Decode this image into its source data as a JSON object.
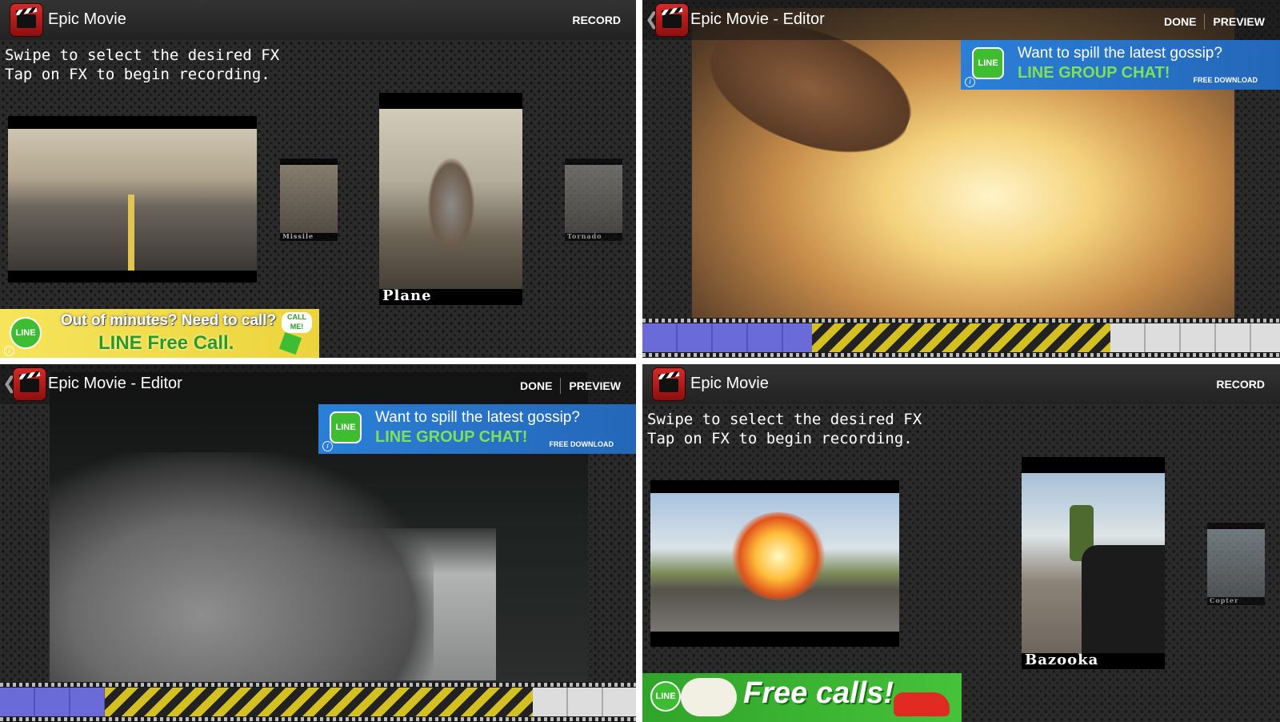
{
  "app": {
    "title": "Epic Movie",
    "editor_title": "Epic Movie - Editor",
    "record_label": "RECORD",
    "done_label": "DONE",
    "preview_label": "PREVIEW",
    "back_glyph": "❮"
  },
  "instructions": {
    "line1": "Swipe to select the desired FX",
    "line2": "Tap on FX to begin recording."
  },
  "gallery_a": {
    "items": [
      {
        "label": "",
        "icon": "bridge-scene"
      },
      {
        "label": "Missile",
        "icon": "missile-fx"
      },
      {
        "label": "Plane",
        "icon": "plane-fx"
      },
      {
        "label": "Tornado",
        "icon": "tornado-fx"
      }
    ]
  },
  "gallery_b": {
    "items": [
      {
        "label": "",
        "icon": "explosion-scene"
      },
      {
        "label": "Bazooka",
        "icon": "bazooka-fx"
      },
      {
        "label": "Copter",
        "icon": "copter-fx"
      }
    ]
  },
  "ads": {
    "call": {
      "line1": "Out of minutes? Need to call?",
      "line2": "LINE Free Call.",
      "badge": "LINE",
      "sticker": "CALL ME!"
    },
    "gossip": {
      "line1": "Want to spill the latest gossip?",
      "line2": "LINE GROUP CHAT!",
      "download": "FREE DOWNLOAD",
      "badge": "LINE"
    },
    "freecalls": {
      "text": "Free calls!",
      "badge": "LINE"
    }
  },
  "info_glyph": "i",
  "colors": {
    "fx_stripe": "#d4c021",
    "recorded": "#6a6ad8",
    "line_green": "#3fbd32"
  }
}
